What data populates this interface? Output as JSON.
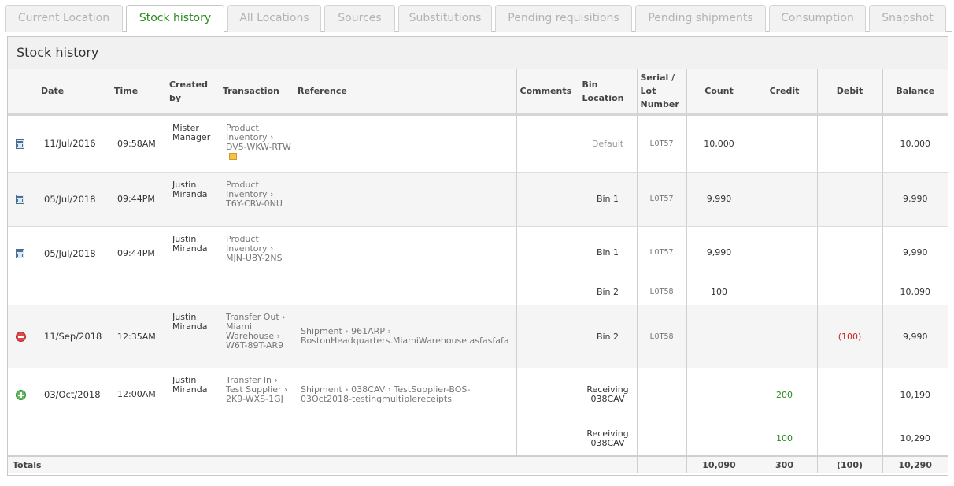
{
  "tabs": [
    "Current Location",
    "Stock history",
    "All Locations",
    "Sources",
    "Substitutions",
    "Pending requisitions",
    "Pending shipments",
    "Consumption",
    "Snapshot"
  ],
  "panel": {
    "title": "Stock history"
  },
  "columns": {
    "date": "Date",
    "time": "Time",
    "created_by": "Created by",
    "transaction": "Transaction",
    "reference": "Reference",
    "comments": "Comments",
    "bin_location": "Bin Location",
    "serial_lot": "Serial / Lot Number",
    "count": "Count",
    "credit": "Credit",
    "debit": "Debit",
    "balance": "Balance"
  },
  "rows": [
    {
      "icon": "calculator-icon",
      "date": "11/Jul/2016",
      "time": "09:58AM",
      "created_by": "Mister Manager",
      "transaction": "Product Inventory › DV5-WKW-RTW",
      "reference": "",
      "bin": "Default",
      "lot": "LOT57",
      "count": "10,000",
      "balance": "10,000"
    },
    {
      "icon": "calculator-icon",
      "date": "05/Jul/2018",
      "time": "09:44PM",
      "created_by": "Justin Miranda",
      "transaction": "Product Inventory › T6Y-CRV-0NU",
      "reference": "",
      "bin": "Bin 1",
      "lot": "LOT57",
      "count": "9,990",
      "balance": "9,990"
    },
    {
      "icon": "calculator-icon",
      "date": "05/Jul/2018",
      "time": "09:44PM",
      "created_by": "Justin Miranda",
      "transaction": "Product Inventory › MJN-U8Y-2NS",
      "reference": "",
      "lines": [
        {
          "bin": "Bin 1",
          "lot": "LOT57",
          "count": "9,990",
          "balance": "9,990"
        },
        {
          "bin": "Bin 2",
          "lot": "LOT58",
          "count": "100",
          "balance": "10,090"
        }
      ]
    },
    {
      "icon": "minus-circle-icon",
      "date": "11/Sep/2018",
      "time": "12:35AM",
      "created_by": "Justin Miranda",
      "transaction": "Transfer Out › Miami Warehouse › W6T-89T-AR9",
      "reference": "Shipment › 961ARP › BostonHeadquarters.MiamiWarehouse.asfasfafa",
      "bin": "Bin 2",
      "lot": "LOT58",
      "debit": "(100)",
      "balance": "9,990"
    },
    {
      "icon": "plus-circle-icon",
      "date": "03/Oct/2018",
      "time": "12:00AM",
      "created_by": "Justin Miranda",
      "transaction": "Transfer In › Test Supplier › 2K9-WXS-1GJ",
      "reference": "Shipment › 038CAV › TestSupplier-BOS-03Oct2018-testingmultiplereceipts",
      "lines": [
        {
          "bin": "Receiving 038CAV",
          "credit": "200",
          "balance": "10,190"
        },
        {
          "bin": "Receiving 038CAV",
          "credit": "100",
          "balance": "10,290"
        }
      ]
    }
  ],
  "totals": {
    "label": "Totals",
    "count": "10,090",
    "credit": "300",
    "debit": "(100)",
    "balance": "10,290"
  },
  "colors": {
    "accent": "#2a8a1e",
    "debit": "#cc2020"
  }
}
